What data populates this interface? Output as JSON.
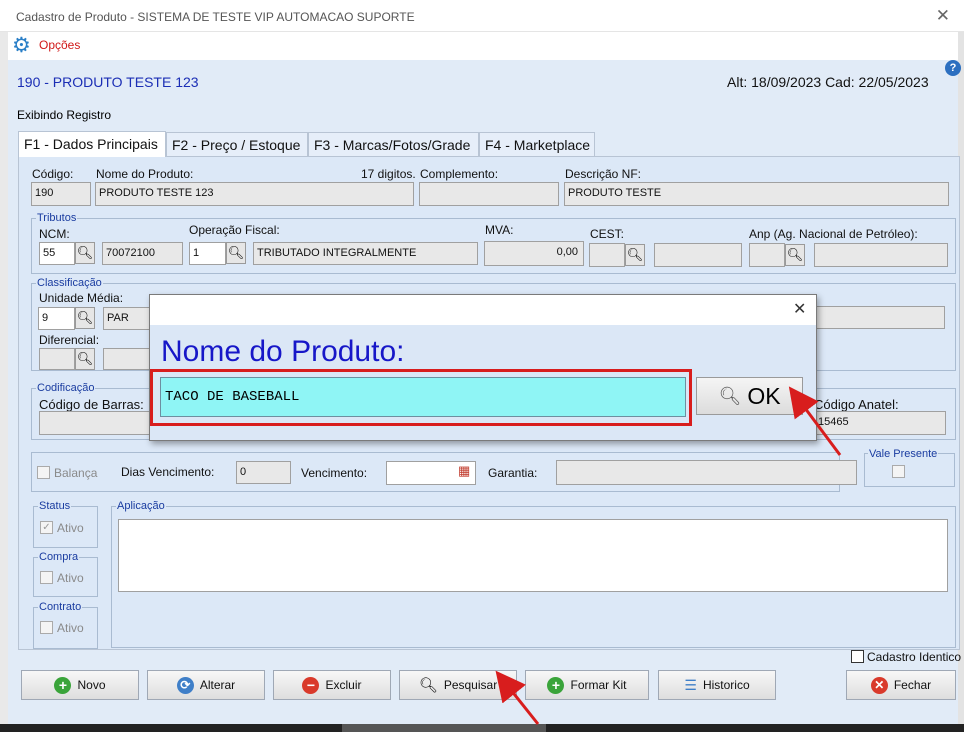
{
  "window": {
    "title": "Cadastro de Produto - SISTEMA DE TESTE VIP AUTOMACAO SUPORTE",
    "menu_opcoes": "Opções",
    "help": "?"
  },
  "header": {
    "product_title": "190 - PRODUTO TESTE 123",
    "dates": "Alt: 18/09/2023 Cad: 22/05/2023",
    "status_text": "Exibindo Registro"
  },
  "tabs": [
    "F1 - Dados Principais",
    "F2 - Preço / Estoque",
    "F3 - Marcas/Fotos/Grade",
    "F4 - Marketplace"
  ],
  "top_fields": {
    "codigo_label": "Código:",
    "codigo_value": "190",
    "nome_label": "Nome do Produto:",
    "nome_value": "PRODUTO TESTE 123",
    "digitos_label": "17 digitos.",
    "complemento_label": "Complemento:",
    "complemento_value": "",
    "descnf_label": "Descrição NF:",
    "descnf_value": "PRODUTO TESTE"
  },
  "tributos": {
    "group_label": "Tributos",
    "ncm_label": "NCM:",
    "ncm_code": "55",
    "ncm_value": "70072100",
    "opfiscal_label": "Operação Fiscal:",
    "opfiscal_code": "1",
    "opfiscal_value": "TRIBUTADO INTEGRALMENTE",
    "mva_label": "MVA:",
    "mva_value": "0,00",
    "cest_label": "CEST:",
    "anp_label": "Anp (Ag. Nacional de Petróleo):"
  },
  "classificacao": {
    "group_label": "Classificação",
    "unidade_label": "Unidade Média:",
    "unidade_code": "9",
    "unidade_value": "PAR",
    "diferencial_label": "Diferencial:"
  },
  "codificacao": {
    "group_label": "Codificação",
    "barras_label": "Código de Barras:",
    "anatel_label": "Código Anatel:",
    "anatel_value": "15465"
  },
  "misc": {
    "balanca_label": "Balança",
    "dias_venc_label": "Dias Vencimento:",
    "dias_venc_value": "0",
    "vencimento_label": "Vencimento:",
    "garantia_label": "Garantia:",
    "vale_presente_label": "Vale Presente"
  },
  "status_groups": {
    "status_label": "Status",
    "status_ativo": "Ativo",
    "compra_label": "Compra",
    "compra_ativo": "Ativo",
    "contrato_label": "Contrato",
    "contrato_ativo": "Ativo",
    "aplicacao_label": "Aplicação"
  },
  "cadastro_identico": "Cadastro Identico",
  "buttons": {
    "novo": "Novo",
    "alterar": "Alterar",
    "excluir": "Excluir",
    "pesquisar": "Pesquisar",
    "formar_kit": "Formar Kit",
    "historico": "Historico",
    "fechar": "Fechar"
  },
  "dialog": {
    "title": "Nome do Produto:",
    "input_value": "TACO DE BASEBALL",
    "ok_label": "OK"
  },
  "colors": {
    "accent": "#1b2eb5",
    "dialog_title": "#1717c8",
    "highlight_red": "#d81d1d",
    "input_cyan": "#8ff5f5"
  }
}
